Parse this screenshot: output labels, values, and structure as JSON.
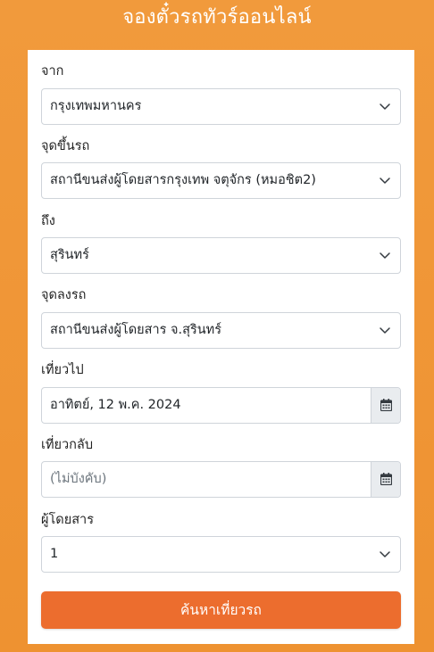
{
  "header": {
    "title": "จองตั๋วรถทัวร์ออนไลน์"
  },
  "form": {
    "from": {
      "label": "จาก",
      "value": "กรุงเทพมหานคร"
    },
    "pickup": {
      "label": "จุดขึ้นรถ",
      "value": "สถานีขนส่งผู้โดยสารกรุงเทพ จตุจักร (หมอชิต2)"
    },
    "to": {
      "label": "ถึง",
      "value": "สุรินทร์"
    },
    "dropoff": {
      "label": "จุดลงรถ",
      "value": "สถานีขนส่งผู้โดยสาร จ.สุรินทร์"
    },
    "depart": {
      "label": "เที่ยวไป",
      "value": "อาทิตย์, 12 พ.ค. 2024"
    },
    "return": {
      "label": "เที่ยวกลับ",
      "placeholder": "(ไม่บังคับ)"
    },
    "passengers": {
      "label": "ผู้โดยสาร",
      "value": "1"
    },
    "submit_label": "ค้นหาเที่ยวรถ"
  },
  "icons": {
    "select_arrow": "chevron-down-icon",
    "date_picker": "calendar-icon"
  },
  "colors": {
    "background": "#f0973a",
    "button": "#ec6d2e",
    "addon": "#e9ecef"
  }
}
